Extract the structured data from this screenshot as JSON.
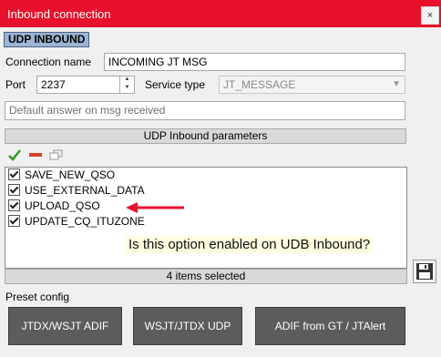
{
  "window": {
    "title": "Inbound connection",
    "close_glyph": "×"
  },
  "section_tag": "UDP INBOUND",
  "connection": {
    "label": "Connection name",
    "value": "INCOMING JT MSG"
  },
  "port": {
    "label": "Port",
    "value": "2237"
  },
  "service_type": {
    "label": "Service type",
    "value": "JT_MESSAGE"
  },
  "default_answer": {
    "placeholder": "Default answer on msg received"
  },
  "parameters": {
    "header": "UDP Inbound parameters",
    "toolbar": [
      "check-all-icon",
      "remove-icon",
      "copy-icon"
    ],
    "items": [
      {
        "label": "SAVE_NEW_QSO",
        "checked": true
      },
      {
        "label": "USE_EXTERNAL_DATA",
        "checked": true
      },
      {
        "label": "UPLOAD_QSO",
        "checked": true
      },
      {
        "label": "UPDATE_CQ_ITUZONE",
        "checked": true
      }
    ],
    "status": "4 items selected"
  },
  "annotation": {
    "text": "Is this option enabled on UDB Inbound?",
    "arrow_color": "#e8112d"
  },
  "preset": {
    "label": "Preset config",
    "buttons": [
      "JTDX/WSJT ADIF",
      "WSJT/JTDX UDP",
      "ADIF from GT / JTAlert"
    ]
  },
  "colors": {
    "titlebar": "#e8112d",
    "preset_button": "#5c5c5c"
  }
}
